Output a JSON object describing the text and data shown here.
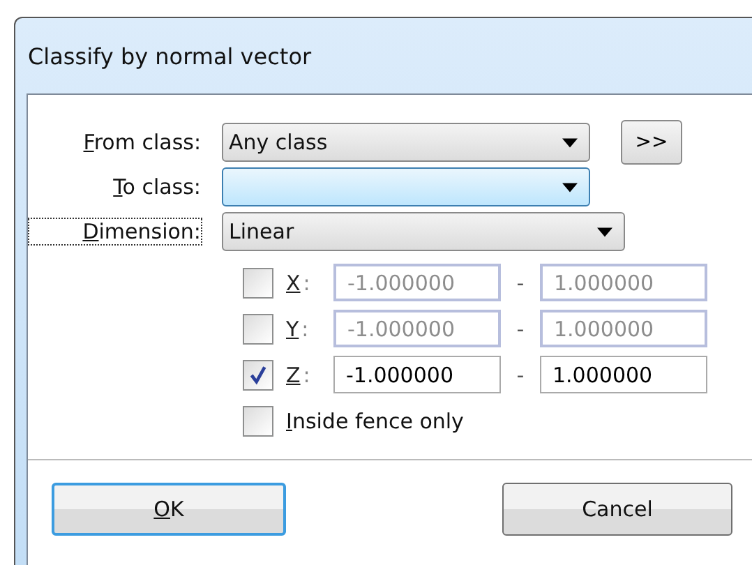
{
  "window": {
    "title": "Classify by normal vector"
  },
  "fields": [
    {
      "label": "From class:",
      "value": "Any class",
      "focused": false
    },
    {
      "label": "To class:",
      "focused": true
    },
    {
      "label": "Dimension:",
      "value": "Linear",
      "focused": false
    }
  ],
  "more_button": ">>",
  "axes": [
    {
      "label": "X",
      "separator": ":",
      "checked": false,
      "min": "-1.000000",
      "dash": "-",
      "max": "1.000000"
    },
    {
      "label": "Y",
      "separator": ":",
      "checked": false,
      "min": "-1.000000",
      "dash": "-",
      "max": "1.000000"
    },
    {
      "label": "Z",
      "separator": ":",
      "checked": true,
      "min": "-1.000000",
      "dash": "-",
      "max": "1.000000"
    }
  ],
  "fence": {
    "label": "Inside fence only",
    "checked": false
  },
  "buttons": [
    {
      "label": "OK",
      "default": true
    },
    {
      "label": "Cancel",
      "default": false
    }
  ]
}
